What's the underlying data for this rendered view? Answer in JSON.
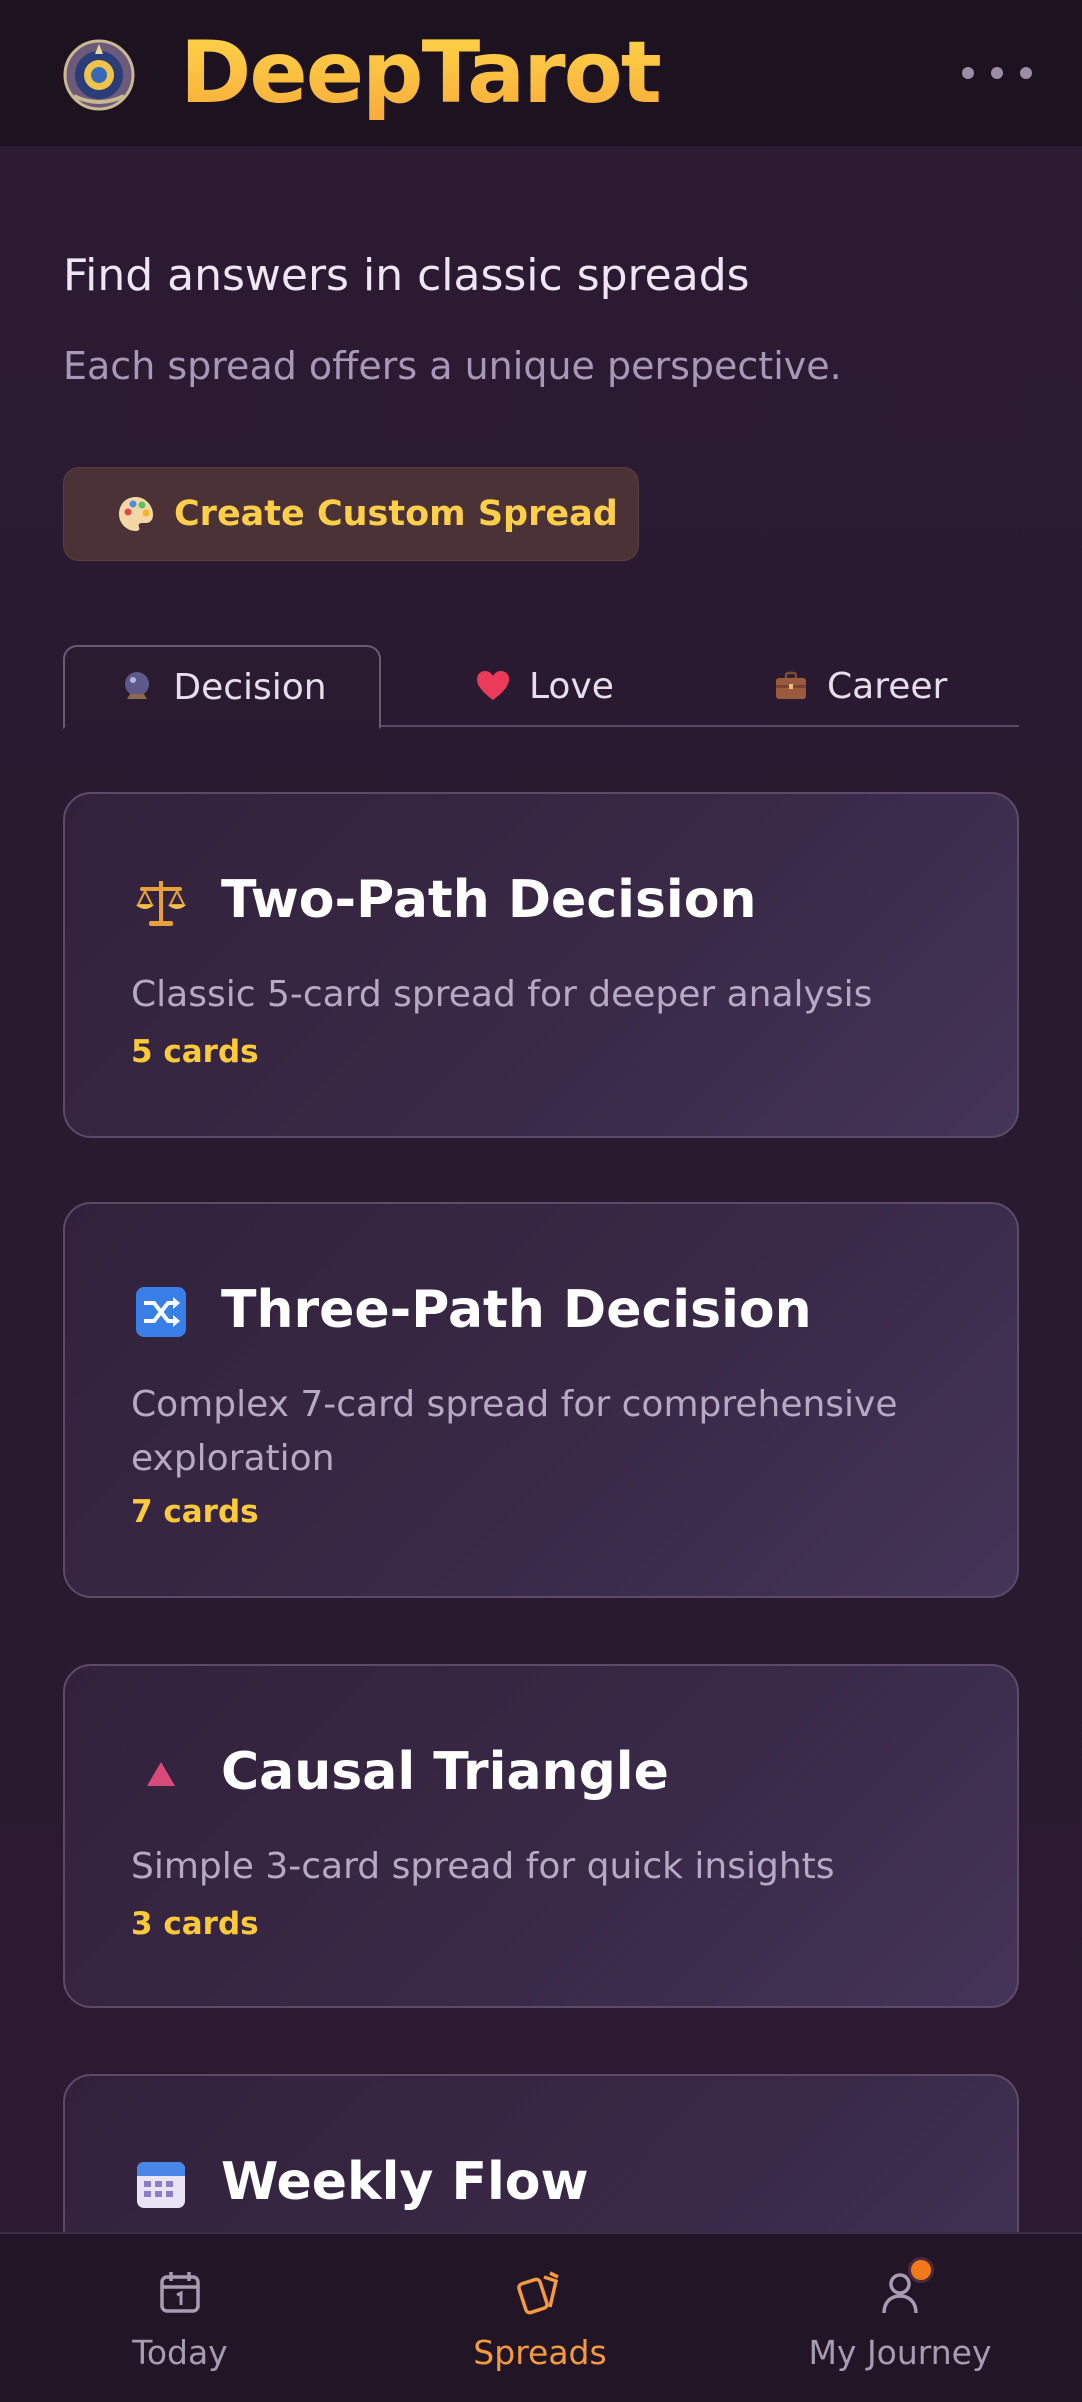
{
  "app": {
    "name": "DeepTarot"
  },
  "intro": {
    "title": "Find answers in classic spreads",
    "subtitle": "Each spread offers a unique perspective."
  },
  "custom_button": {
    "label": "Create Custom Spread",
    "icon": "palette-icon"
  },
  "tabs": [
    {
      "label": "Decision",
      "icon": "crystal-ball-icon",
      "active": true
    },
    {
      "label": "Love",
      "icon": "heart-icon",
      "active": false
    },
    {
      "label": "Career",
      "icon": "briefcase-icon",
      "active": false
    }
  ],
  "spreads": [
    {
      "icon": "scales-icon",
      "title": "Two-Path Decision",
      "description": "Classic 5-card spread for deeper analysis",
      "count": "5 cards"
    },
    {
      "icon": "shuffle-icon",
      "title": "Three-Path Decision",
      "description": "Complex 7-card spread for comprehensive exploration",
      "count": "7 cards"
    },
    {
      "icon": "triangle-icon",
      "title": "Causal Triangle",
      "description": "Simple 3-card spread for quick insights",
      "count": "3 cards"
    },
    {
      "icon": "calendar-icon",
      "title": "Weekly Flow",
      "description": "",
      "count": ""
    }
  ],
  "bottom_nav": [
    {
      "label": "Today",
      "icon": "calendar-day-icon",
      "active": false
    },
    {
      "label": "Spreads",
      "icon": "cards-icon",
      "active": true
    },
    {
      "label": "My Journey",
      "icon": "user-icon",
      "active": false,
      "badge": true
    }
  ],
  "colors": {
    "accent": "#ffca3a",
    "nav_active": "#f59a3e",
    "background": "#2a1a30"
  }
}
